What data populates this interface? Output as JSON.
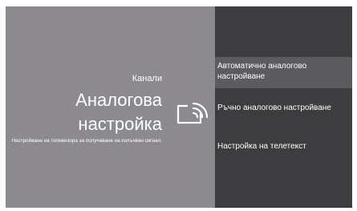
{
  "info_panel": {
    "section": "Канали",
    "title": "Аналогова настройка",
    "description": "Настройване на телевизора за получаване на излъчван сигнал."
  },
  "menu": {
    "items": [
      {
        "label": "Автоматично аналогово настройване",
        "selected": true
      },
      {
        "label": "Ръчно аналогово настройване",
        "selected": false
      },
      {
        "label": "Настройка на телетекст",
        "selected": false
      }
    ]
  },
  "icons": {
    "section_icon": "tv-broadcast-icon"
  },
  "colors": {
    "info_background": "#8d8a8f",
    "menu_background": "#3d3d3f",
    "selected_item": "#5b5b60",
    "text": "#ffffff"
  }
}
